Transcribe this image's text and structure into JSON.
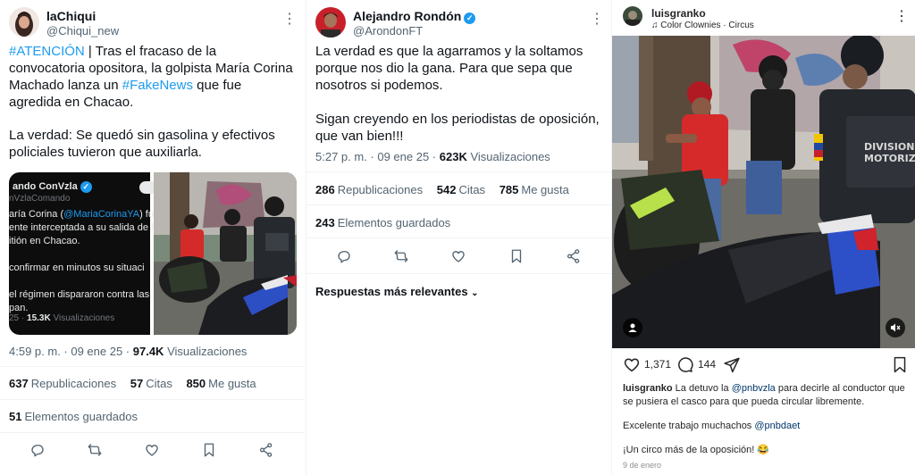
{
  "tweet1": {
    "user_name": "laChiqui",
    "handle": "@Chiqui_new",
    "text": {
      "hashtag1": "#ATENCIÓN",
      "part1": " | Tras el fracaso de la convocatoria opositora, la golpista María Corina Machado lanza un ",
      "hashtag2": "#FakeNews",
      "part2": " que fue agredida en Chacao.",
      "part3": "La verdad: Se quedó sin gasolina y efectivos policiales tuvieron que auxiliarla."
    },
    "quote": {
      "name": "ando ConVzla",
      "handle": "nVzlaComando",
      "text_a": "aría Corina (",
      "mention": "@MariaCorinaYA",
      "text_b": ") fue\nente interceptada a su salida de l\nitión en Chacao.",
      "text_c": "confirmar en minutos su situaci",
      "text_d": "el régimen dispararon contra las\npan.",
      "meta_time": "25 · ",
      "meta_views": "15.3K",
      "meta_label": " Visualizaciones"
    },
    "time": "4:59 p. m. · 09 ene 25 · ",
    "views": "97.4K",
    "views_label": " Visualizaciones",
    "reposts": "637",
    "reposts_label": "Republicaciones",
    "quotes": "57",
    "quotes_label": "Citas",
    "likes": "850",
    "likes_label": "Me gusta",
    "bookmarks": "51",
    "bookmarks_label": "Elementos guardados"
  },
  "tweet2": {
    "user_name": "Alejandro Rondón",
    "handle": "@ArondonFT",
    "text1": "La verdad es que la agarramos y la soltamos porque nos dio la gana. Para que sepa que nosotros si podemos.",
    "text2": "Sigan creyendo en los periodistas de oposición, que van bien!!!",
    "time": "5:27 p. m. · 09 ene 25 · ",
    "views": "623K",
    "views_label": " Visualizaciones",
    "reposts": "286",
    "reposts_label": "Republicaciones",
    "quotes": "542",
    "quotes_label": "Citas",
    "likes": "785",
    "likes_label": "Me gusta",
    "bookmarks": "243",
    "bookmarks_label": "Elementos guardados",
    "sort_label": "Respuestas más relevantes"
  },
  "instagram": {
    "user_name": "luisgranko",
    "song": "Color Clownies · Circus",
    "likes": "1,371",
    "comments": "144",
    "caption_user": "luisgranko",
    "caption_a": " La detuvo la ",
    "caption_mention1": "@pnbvzla",
    "caption_b": " para decirle al conductor que se pusiera el casco para que pueda circular libremente.",
    "caption2_a": "Excelente trabajo muchachos ",
    "caption2_mention": "@pnbdaet",
    "caption3": "¡Un circo más de la oposición! 😂",
    "date": "9 de enero",
    "vest_text": "DIVISION MOTORIZADA"
  }
}
